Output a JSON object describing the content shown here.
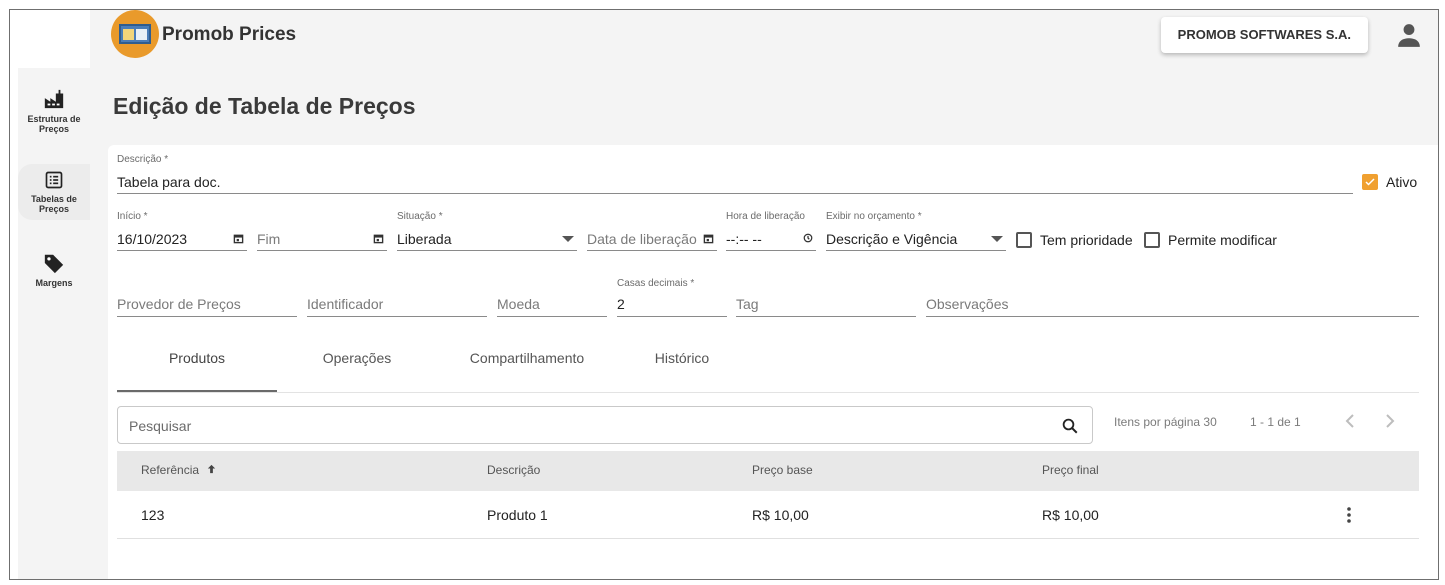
{
  "app": {
    "title": "Promob Prices",
    "company": "PROMOB SOFTWARES S.A."
  },
  "sidebar": {
    "items": [
      {
        "label_line1": "Estrutura de",
        "label_line2": "Preços",
        "icon": "factory-icon"
      },
      {
        "label_line1": "Tabelas de",
        "label_line2": "Preços",
        "icon": "list-icon"
      },
      {
        "label_line1": "Margens",
        "label_line2": "",
        "icon": "tag-icon"
      }
    ]
  },
  "page": {
    "title": "Edição de Tabela de Preços"
  },
  "form": {
    "descricao": {
      "label": "Descrição *",
      "value": "Tabela para doc."
    },
    "ativo": {
      "label": "Ativo",
      "checked": true
    },
    "inicio": {
      "label": "Início *",
      "value": "16/10/2023"
    },
    "fim": {
      "placeholder": "Fim"
    },
    "situacao": {
      "label": "Situação *",
      "value": "Liberada"
    },
    "data_liberacao": {
      "placeholder": "Data de liberação"
    },
    "hora_liberacao": {
      "label": "Hora de liberação",
      "value": "--:-- --"
    },
    "exibir_orcamento": {
      "label": "Exibir no orçamento *",
      "value": "Descrição e Vigência"
    },
    "tem_prioridade": {
      "label": "Tem prioridade",
      "checked": false
    },
    "permite_modificar": {
      "label": "Permite modificar",
      "checked": false
    },
    "provedor": {
      "placeholder": "Provedor de Preços"
    },
    "identificador": {
      "placeholder": "Identificador"
    },
    "moeda": {
      "placeholder": "Moeda"
    },
    "casas_decimais": {
      "label": "Casas decimais *",
      "value": "2"
    },
    "tag": {
      "placeholder": "Tag"
    },
    "observacoes": {
      "placeholder": "Observações"
    }
  },
  "tabs": [
    "Produtos",
    "Operações",
    "Compartilhamento",
    "Histórico"
  ],
  "search": {
    "placeholder": "Pesquisar"
  },
  "pagination": {
    "items_per_page": "Itens por página 30",
    "range": "1 - 1 de 1"
  },
  "table": {
    "headers": [
      "Referência",
      "Descrição",
      "Preço base",
      "Preço final"
    ],
    "rows": [
      {
        "referencia": "123",
        "descricao": "Produto 1",
        "preco_base": "R$ 10,00",
        "preco_final": "R$ 10,00"
      }
    ]
  },
  "colors": {
    "accent": "#f0a030",
    "logo": "#e99a2b"
  }
}
